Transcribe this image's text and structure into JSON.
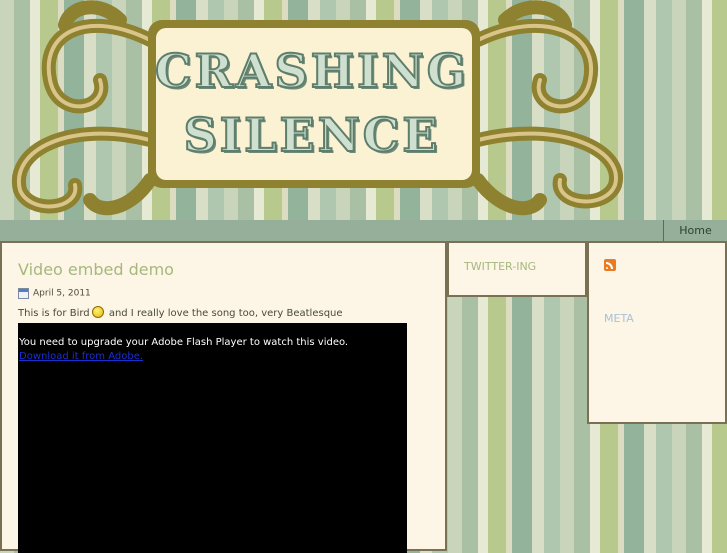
{
  "site": {
    "title_line_1": "CRASHING",
    "title_line_2": "SILENCE"
  },
  "nav": {
    "home_label": "Home"
  },
  "post": {
    "title": "Video embed demo",
    "date": "April 5, 2011",
    "body_before_smiley": "This is for Bird",
    "body_after_smiley": " and I really love the song too, very Beatlesque",
    "video": {
      "upgrade_message": "You need to upgrade your Adobe Flash Player to watch this video.",
      "download_link": "Download it from Adobe."
    }
  },
  "sidebar": {
    "twitter_heading": "TWITTER-ING",
    "meta_heading": "META"
  },
  "icons": {
    "calendar": "calendar-icon",
    "smiley": "smiley-icon",
    "rss": "rss-icon"
  },
  "colors": {
    "panel_background": "#fdf5e6",
    "panel_border": "#7a7053",
    "heading_green": "#a6b87d",
    "nav_bar": "#95af9a"
  }
}
